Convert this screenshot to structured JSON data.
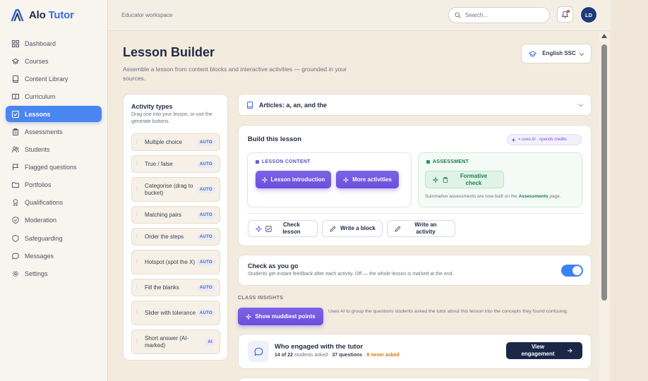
{
  "app": {
    "logo_main": "Alo",
    "logo_accent": "Tutor",
    "brand_color": "#3b6fd8"
  },
  "sidebar": {
    "items": [
      {
        "label": "Dashboard",
        "icon": "grid-icon",
        "active": false
      },
      {
        "label": "Courses",
        "icon": "graduation-cap-icon",
        "active": false
      },
      {
        "label": "Content Library",
        "icon": "book-icon",
        "active": false
      },
      {
        "label": "Curriculum",
        "icon": "open-book-icon",
        "active": false
      },
      {
        "label": "Lessons",
        "icon": "checklist-icon",
        "active": true
      },
      {
        "label": "Assessments",
        "icon": "clipboard-icon",
        "active": false
      },
      {
        "label": "Students",
        "icon": "users-icon",
        "active": false
      },
      {
        "label": "Flagged questions",
        "icon": "flag-icon",
        "active": false
      },
      {
        "label": "Portfolios",
        "icon": "folder-icon",
        "active": false
      },
      {
        "label": "Qualifications",
        "icon": "award-icon",
        "active": false
      },
      {
        "label": "Moderation",
        "icon": "shield-check-icon",
        "active": false
      },
      {
        "label": "Safeguarding",
        "icon": "shield-icon",
        "active": false
      },
      {
        "label": "Messages",
        "icon": "chat-icon",
        "active": false
      },
      {
        "label": "Settings",
        "icon": "gear-icon",
        "active": false
      }
    ]
  },
  "topbar": {
    "workspace": "Educator workspace",
    "search_placeholder": "Search...",
    "avatar_initials": "LD"
  },
  "page": {
    "title": "Lesson Builder",
    "subtitle": "Assemble a lesson from content blocks and interactive activities — grounded in your sources.",
    "language": "English SSC"
  },
  "activity_panel": {
    "title": "Activity types",
    "subtitle": "Drag one into your lesson, or use the generate buttons.",
    "items": [
      {
        "label": "Multiple choice",
        "tag": "AUTO",
        "ai": false
      },
      {
        "label": "True / false",
        "tag": "AUTO",
        "ai": false
      },
      {
        "label": "Categorise (drag to bucket)",
        "tag": "AUTO",
        "ai": false
      },
      {
        "label": "Matching pairs",
        "tag": "AUTO",
        "ai": false
      },
      {
        "label": "Order the steps",
        "tag": "AUTO",
        "ai": false
      },
      {
        "label": "Hotspot (spot the X)",
        "tag": "AUTO",
        "ai": false
      },
      {
        "label": "Fill the blanks",
        "tag": "AUTO",
        "ai": false
      },
      {
        "label": "Slider with tolerance",
        "tag": "AUTO",
        "ai": false
      },
      {
        "label": "Short answer (AI-marked)",
        "tag": "AI",
        "ai": true
      }
    ]
  },
  "article": {
    "label": "Articles: a, an, and the"
  },
  "build": {
    "title": "Build this lesson",
    "ai_legend": "= uses AI · spends credits",
    "lesson_content_head": "LESSON CONTENT",
    "lesson_intro": "Lesson introduction",
    "more_activities": "More activities",
    "assessment_head": "ASSESSMENT",
    "formative": "Formative check",
    "summative_note": "Summative assessments are now built on the",
    "summative_link": "Assessments",
    "summative_tail": "page.",
    "check_lesson": "Check lesson",
    "write_block": "Write a block",
    "write_activity": "Write an activity"
  },
  "check": {
    "title": "Check as you go",
    "subtitle": "Students get instant feedback after each activity. Off — the whole lesson is marked at the end.",
    "enabled": true
  },
  "insights": {
    "label": "CLASS INSIGHTS",
    "muddiest_button": "Show muddiest points",
    "muddiest_note": "Uses AI to group the questions students asked the tutor about this lesson into the concepts they found confusing.",
    "engaged_title": "Who engaged with the tutor",
    "stat_students": "14 of 22",
    "stat_students_label": "students asked ·",
    "stat_questions": "37 questions",
    "stat_sep": "·",
    "stat_never": "8 never asked",
    "view_button": "View engagement"
  }
}
